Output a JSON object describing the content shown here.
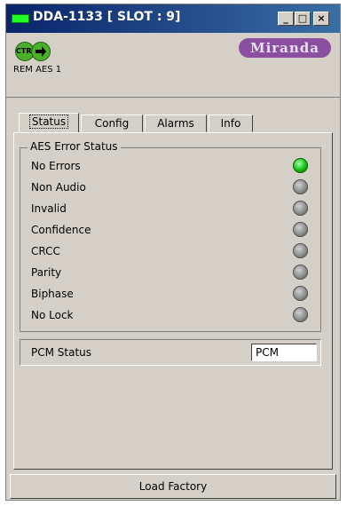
{
  "window": {
    "title": "DDA-1133 [ SLOT : 9]",
    "min_label": "_",
    "max_label": "□",
    "close_label": "×"
  },
  "header": {
    "ctrl_label": "CTRL",
    "rem_label": "REM AES 1",
    "logo": "Miranda"
  },
  "tabs": [
    "Status",
    "Config",
    "Alarms",
    "Info"
  ],
  "aes_group": {
    "title": "AES Error Status",
    "rows": [
      {
        "label": "No Errors",
        "state": "green"
      },
      {
        "label": "Non Audio",
        "state": "grey"
      },
      {
        "label": "Invalid",
        "state": "grey"
      },
      {
        "label": "Confidence",
        "state": "grey"
      },
      {
        "label": "CRCC",
        "state": "grey"
      },
      {
        "label": "Parity",
        "state": "grey"
      },
      {
        "label": "Biphase",
        "state": "grey"
      },
      {
        "label": "No Lock",
        "state": "grey"
      }
    ]
  },
  "pcm": {
    "label": "PCM Status",
    "value": "PCM"
  },
  "footer": {
    "load_factory": "Load Factory"
  },
  "colors": {
    "led_on": "#10c010",
    "led_off": "#8a8a8a",
    "logo": "#8a4fa0"
  }
}
